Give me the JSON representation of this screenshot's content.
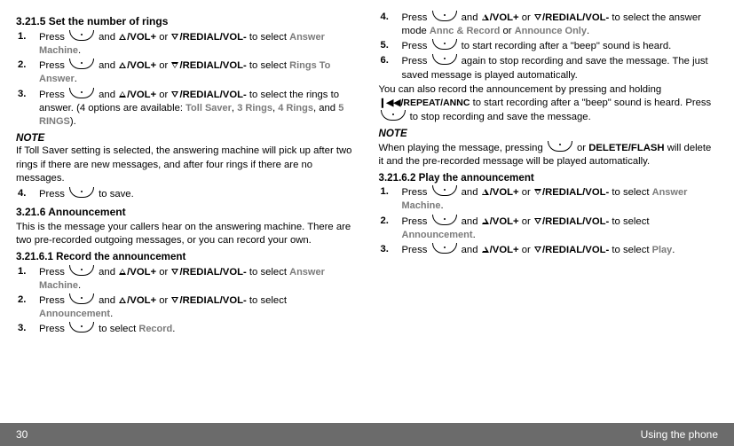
{
  "left": {
    "h1": "3.21.5    Set the number of rings",
    "s1": [
      {
        "pre": "Press ",
        "vol": "/VOL+",
        "or": " or ",
        "red": "/REDIAL/VOL-",
        "post": " to select ",
        "g": "Answer Machine",
        "end": "."
      },
      {
        "pre": "Press ",
        "vol": "/VOL+",
        "or": " or ",
        "red": "/REDIAL/VOL-",
        "post": " to select ",
        "g": "Rings To Answer",
        "end": "."
      },
      {
        "pre": "Press ",
        "vol": "/VOL+",
        "or": " or ",
        "red": "/REDIAL/VOL-",
        "post": " to select the rings to answer. (4 options are available: ",
        "g1": "Toll Saver",
        "c1": ", ",
        "g2": "3 Rings",
        "c2": ", ",
        "g3": "4 Rings",
        "c3": ", and ",
        "g4": "5 RINGS",
        "end": ")."
      }
    ],
    "noteH": "NOTE",
    "noteBody": "If Toll Saver setting is selected, the answering machine will pick up after two rings if there are new messages, and after four rings if there are no messages.",
    "s1b": {
      "pre": "Press ",
      "post": " to save."
    },
    "h2": "3.21.6    Announcement",
    "h2body": "This is the message your callers hear on the answering machine. There are two pre-recorded outgoing messages, or you can record your own.",
    "h3": "3.21.6.1 Record the announcement",
    "s2": [
      {
        "pre": "Press ",
        "vol": "/VOL+",
        "or": " or ",
        "red": "/REDIAL/VOL-",
        "post": " to select ",
        "g": "Answer Machine",
        "end": "."
      },
      {
        "pre": "Press ",
        "vol": "/VOL+",
        "or": " or ",
        "red": "/REDIAL/VOL-",
        "post": " to select ",
        "g": "Announcement",
        "end": "."
      },
      {
        "pre": "Press ",
        "post": " to select ",
        "g": "Record",
        "end": "."
      }
    ]
  },
  "right": {
    "s3": [
      {
        "pre": "Press ",
        "vol": "/VOL+",
        "or": " or ",
        "red": "/REDIAL/VOL-",
        "post": " to select the answer mode ",
        "g1": "Annc & Record",
        "mid": " or ",
        "g2": "Announce Only",
        "end": "."
      },
      {
        "pre": "Press ",
        "post": " to start recording after a \"beep\" sound is heard."
      },
      {
        "pre": "Press ",
        "post": " again to stop recording and save the message. The just saved message is played automatically."
      }
    ],
    "paraA": "You can also record the announcement by pressing and holding ",
    "repeat": "❙◀◀/REPEAT/ANNC",
    "paraB": " to start recording after a \"beep\" sound is heard. Press ",
    "paraC": " to stop recording and save the message.",
    "noteH": "NOTE",
    "noteBodyA": "When playing the message, pressing ",
    "noteBodyB": " or ",
    "delflash": "DELETE/FLASH",
    "noteBodyC": " will delete it and the pre-recorded message will be played automatically.",
    "h4": "3.21.6.2 Play the announcement",
    "s4": [
      {
        "pre": "Press ",
        "vol": "/VOL+",
        "or": " or ",
        "red": "/REDIAL/VOL-",
        "post": " to select ",
        "g": "Answer Machine",
        "end": "."
      },
      {
        "pre": "Press ",
        "vol": "/VOL+",
        "or": " or ",
        "red": "/REDIAL/VOL-",
        "post": " to select ",
        "g": "Announcement",
        "end": "."
      },
      {
        "pre": "Press ",
        "vol": "/VOL+",
        "or": " or ",
        "red": "/REDIAL/VOL-",
        "post": " to select ",
        "g": "Play",
        "end": "."
      }
    ]
  },
  "footer": {
    "page": "30",
    "label": "Using the phone"
  }
}
